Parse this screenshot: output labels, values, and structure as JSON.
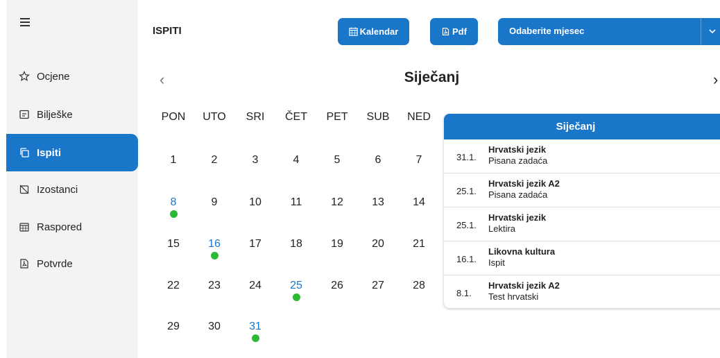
{
  "sidebar": {
    "items": [
      {
        "label": "Ocjene",
        "icon": "star-icon"
      },
      {
        "label": "Bilješke",
        "icon": "notes-icon"
      },
      {
        "label": "Ispiti",
        "icon": "copy-icon",
        "active": true
      },
      {
        "label": "Izostanci",
        "icon": "absence-icon"
      },
      {
        "label": "Raspored",
        "icon": "calendar-grid-icon"
      },
      {
        "label": "Potvrde",
        "icon": "pdf-icon"
      }
    ]
  },
  "header": {
    "title": "ISPITI",
    "calendar_button": "Kalendar",
    "pdf_button": "Pdf",
    "month_select": "Odaberite mjesec"
  },
  "calendar": {
    "month": "Siječanj",
    "prev_label": "‹",
    "next_label": "›",
    "weekdays": [
      "PON",
      "UTO",
      "SRI",
      "ČET",
      "PET",
      "SUB",
      "NED"
    ],
    "days": [
      "1",
      "2",
      "3",
      "4",
      "5",
      "6",
      "7",
      "8",
      "9",
      "10",
      "11",
      "12",
      "13",
      "14",
      "15",
      "16",
      "17",
      "18",
      "19",
      "20",
      "21",
      "22",
      "23",
      "24",
      "25",
      "26",
      "27",
      "28",
      "29",
      "30",
      "31"
    ],
    "exam_days": [
      8,
      16,
      25,
      31
    ]
  },
  "exam_panel": {
    "title": "Siječanj",
    "events": [
      {
        "date": "31.1.",
        "subject": "Hrvatski jezik",
        "type": "Pisana zadaća"
      },
      {
        "date": "25.1.",
        "subject": "Hrvatski jezik A2",
        "type": "Pisana zadaća"
      },
      {
        "date": "25.1.",
        "subject": "Hrvatski jezik",
        "type": "Lektira"
      },
      {
        "date": "16.1.",
        "subject": "Likovna kultura",
        "type": "Ispit"
      },
      {
        "date": "8.1.",
        "subject": "Hrvatski jezik A2",
        "type": "Test hrvatski"
      }
    ]
  },
  "colors": {
    "accent": "#1a76c9",
    "exam_dot": "#2db935",
    "sidebar_bg": "#f3f3f3"
  }
}
